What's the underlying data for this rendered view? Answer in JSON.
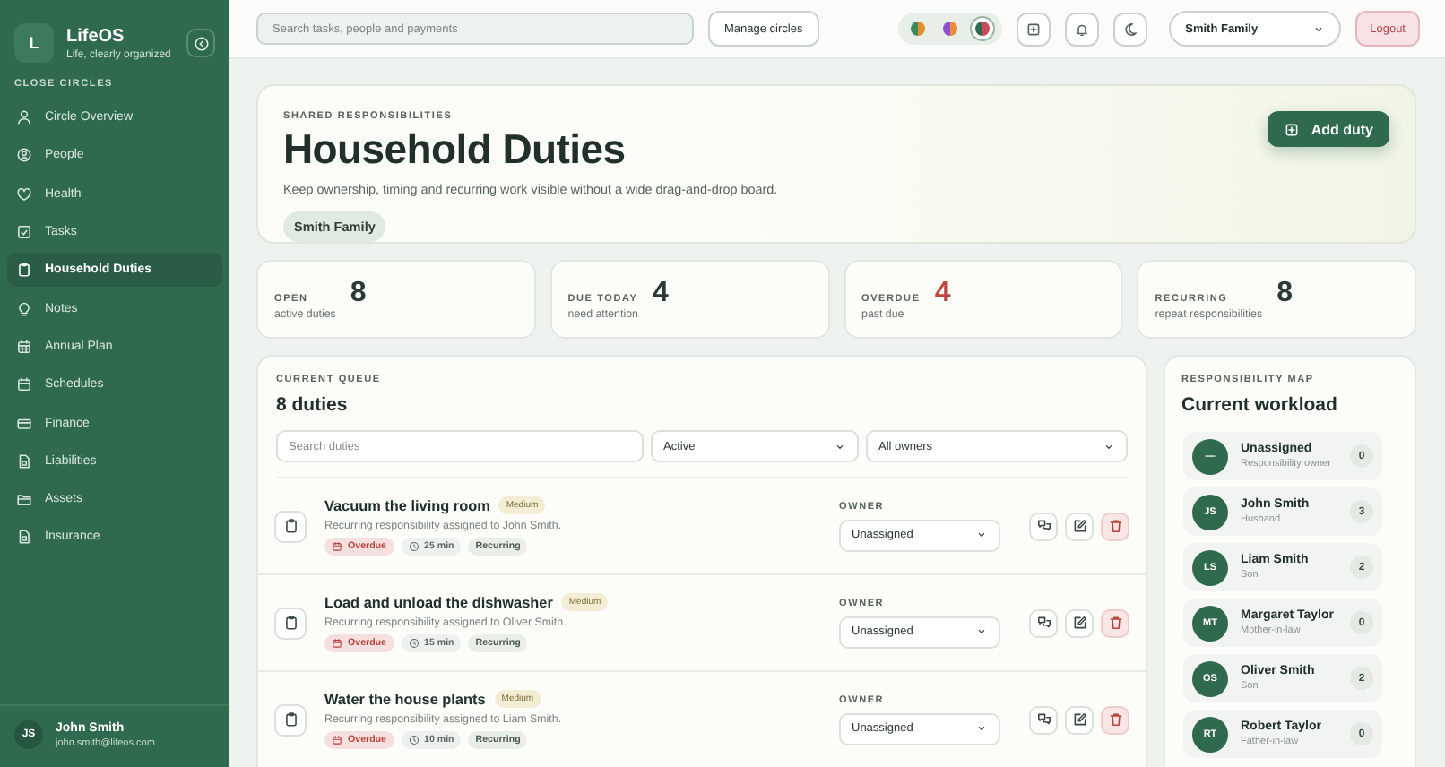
{
  "sidebar": {
    "logo": "L",
    "name": "LifeOS",
    "tagline": "Life, clearly organized",
    "section_label": "CLOSE CIRCLES",
    "items": [
      {
        "label": "Circle Overview",
        "selected": false
      },
      {
        "label": "People",
        "selected": false
      },
      {
        "label": "Health",
        "selected": false
      },
      {
        "label": "Tasks",
        "selected": false
      },
      {
        "label": "Household Duties",
        "selected": true
      },
      {
        "label": "Notes",
        "selected": false
      },
      {
        "label": "Annual Plan",
        "selected": false
      },
      {
        "label": "Schedules",
        "selected": false
      },
      {
        "label": "Finance",
        "selected": false
      },
      {
        "label": "Liabilities",
        "selected": false
      },
      {
        "label": "Assets",
        "selected": false
      },
      {
        "label": "Insurance",
        "selected": false
      }
    ],
    "user": {
      "initials": "JS",
      "name": "John Smith",
      "email": "john.smith@lifeos.com"
    }
  },
  "topbar": {
    "search_placeholder": "Search tasks, people and payments",
    "manage_button": "Manage circles",
    "themes": [
      {
        "selected": false
      },
      {
        "selected": false
      },
      {
        "selected": true
      }
    ],
    "circle_select": "Smith Family",
    "logout_button": "Logout"
  },
  "hero": {
    "eyebrow": "SHARED RESPONSIBILITIES",
    "title": "Household Duties",
    "description": "Keep ownership, timing and recurring work visible without a wide drag-and-drop board.",
    "chip": "Smith Family",
    "add_button": "Add duty"
  },
  "stats": [
    {
      "label": "OPEN",
      "value": "8",
      "caption": "active duties",
      "kind": "normal"
    },
    {
      "label": "DUE TODAY",
      "value": "4",
      "caption": "need attention",
      "kind": "normal"
    },
    {
      "label": "OVERDUE",
      "value": "4",
      "caption": "past due",
      "kind": "alert"
    },
    {
      "label": "RECURRING",
      "value": "8",
      "caption": "repeat responsibilities",
      "kind": "normal"
    }
  ],
  "queue": {
    "eyebrow": "CURRENT QUEUE",
    "title": "8 duties",
    "search_placeholder": "Search duties",
    "status_filter": "Active",
    "owner_filter": "All owners",
    "duties": [
      {
        "title": "Vacuum the living room",
        "priority": "Medium",
        "description": "Recurring responsibility assigned to John Smith.",
        "tags": [
          {
            "kind": "overdue",
            "label": "Overdue"
          },
          {
            "kind": "time",
            "label": "25 min"
          },
          {
            "kind": "plain",
            "label": "Recurring"
          }
        ],
        "owner_label": "OWNER",
        "owner": "Unassigned"
      },
      {
        "title": "Load and unload the dishwasher",
        "priority": "Medium",
        "description": "Recurring responsibility assigned to Oliver Smith.",
        "tags": [
          {
            "kind": "overdue",
            "label": "Overdue"
          },
          {
            "kind": "time",
            "label": "15 min"
          },
          {
            "kind": "plain",
            "label": "Recurring"
          }
        ],
        "owner_label": "OWNER",
        "owner": "Unassigned"
      },
      {
        "title": "Water the house plants",
        "priority": "Medium",
        "description": "Recurring responsibility assigned to Liam Smith.",
        "tags": [
          {
            "kind": "overdue",
            "label": "Overdue"
          },
          {
            "kind": "time",
            "label": "10 min"
          },
          {
            "kind": "plain",
            "label": "Recurring"
          }
        ],
        "owner_label": "OWNER",
        "owner": "Unassigned"
      }
    ]
  },
  "workload": {
    "eyebrow": "RESPONSIBILITY MAP",
    "title": "Current workload",
    "people": [
      {
        "initials": "—",
        "name": "Unassigned",
        "role": "Responsibility owner",
        "count": "0"
      },
      {
        "initials": "JS",
        "name": "John Smith",
        "role": "Husband",
        "count": "3"
      },
      {
        "initials": "LS",
        "name": "Liam Smith",
        "role": "Son",
        "count": "2"
      },
      {
        "initials": "MT",
        "name": "Margaret Taylor",
        "role": "Mother-in-law",
        "count": "0"
      },
      {
        "initials": "OS",
        "name": "Oliver Smith",
        "role": "Son",
        "count": "2"
      },
      {
        "initials": "RT",
        "name": "Robert Taylor",
        "role": "Father-in-law",
        "count": "0"
      }
    ]
  }
}
